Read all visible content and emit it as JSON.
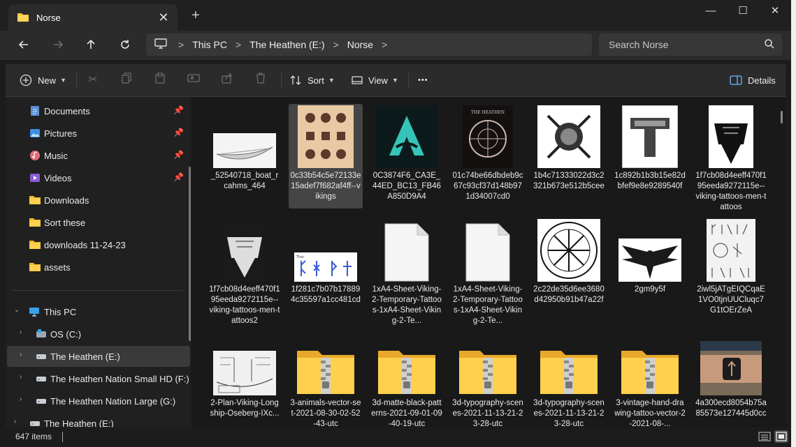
{
  "tab": {
    "title": "Norse",
    "close": "✕",
    "new": "+"
  },
  "window_controls": {
    "minimize": "—",
    "maximize": "☐",
    "close": "✕"
  },
  "address": {
    "crumbs": [
      "This PC",
      "The Heathen (E:)",
      "Norse"
    ],
    "sep": ">"
  },
  "search": {
    "placeholder": "Search Norse"
  },
  "toolbar": {
    "new_label": "New",
    "sort_label": "Sort",
    "view_label": "View",
    "more_label": "•••",
    "details_label": "Details"
  },
  "sidebar": {
    "quick": [
      {
        "label": "Documents",
        "icon": "documents-icon"
      },
      {
        "label": "Pictures",
        "icon": "pictures-icon"
      },
      {
        "label": "Music",
        "icon": "music-icon"
      },
      {
        "label": "Videos",
        "icon": "videos-icon"
      },
      {
        "label": "Downloads",
        "icon": "folder-icon"
      },
      {
        "label": "Sort these",
        "icon": "folder-icon"
      },
      {
        "label": "downloads 11-24-23",
        "icon": "folder-icon"
      },
      {
        "label": "assets",
        "icon": "folder-icon"
      }
    ],
    "this_pc": "This PC",
    "drives": [
      "OS (C:)",
      "The Heathen (E:)",
      "The Heathen Nation Small HD (F:)",
      "The Heathen Nation Large (G:)",
      "The Heathen (E:)"
    ]
  },
  "files": [
    {
      "name": "_52540718_boat_rcahms_464",
      "kind": "boat"
    },
    {
      "name": "0c33b54c5e72133e15adef7f682af4ff--vikings",
      "kind": "runes-card"
    },
    {
      "name": "0C3874F6_CA3E_44ED_BC13_FB46A850D9A4",
      "kind": "assassin"
    },
    {
      "name": "01c74be66dbdeb9c67c93cf37d148b971d34007cd0",
      "kind": "circle-dark"
    },
    {
      "name": "1b4c71333022d3c2321b673e512b5cee",
      "kind": "axes"
    },
    {
      "name": "1c892b1b3b15e82dbfef9e8e9289540f",
      "kind": "hammer"
    },
    {
      "name": "1f7cb08d4eeff470f195eeda9272115e--viking-tattoos-men-tattoos",
      "kind": "hammer-dark"
    },
    {
      "name": "1f7cb08d4eeff470f195eeda9272115e--viking-tattoos-men-tattoos2",
      "kind": "hammer-dark2"
    },
    {
      "name": "1f281c7b07b178894c35597a1cc481cd",
      "kind": "runes-blue"
    },
    {
      "name": "1xA4-Sheet-Viking-2-Temporary-Tattoos-1xA4-Sheet-Viking-2-Te...",
      "kind": "blank"
    },
    {
      "name": "1xA4-Sheet-Viking-2-Temporary-Tattoos-1xA4-Sheet-Viking-2-Te...",
      "kind": "blank"
    },
    {
      "name": "2c22de35d6ee3680d42950b91b47a22f",
      "kind": "vegvisir"
    },
    {
      "name": "2gm9y5f",
      "kind": "raven"
    },
    {
      "name": "2iwl5jATgEIQCqaE1VO0tjnUUCluqc7G1tOErZeA",
      "kind": "runes-sheet"
    },
    {
      "name": "2-Plan-Viking-Longship-Oseberg-IXc...",
      "kind": "plan"
    },
    {
      "name": "3-animals-vector-set-2021-08-30-02-52-43-utc",
      "kind": "zip"
    },
    {
      "name": "3d-matte-black-patterns-2021-09-01-09-40-19-utc",
      "kind": "zip"
    },
    {
      "name": "3d-typography-scenes-2021-11-13-21-23-28-utc",
      "kind": "zip"
    },
    {
      "name": "3d-typography-scenes-2021-11-13-21-23-28-utc",
      "kind": "zip"
    },
    {
      "name": "3-vintage-hand-drawing-tattoo-vector-2-2021-08-...",
      "kind": "zip"
    },
    {
      "name": "4a300ecd8054b75a85573e127445d0cc",
      "kind": "tattoo-photo"
    }
  ],
  "status": {
    "count": "647 items"
  }
}
